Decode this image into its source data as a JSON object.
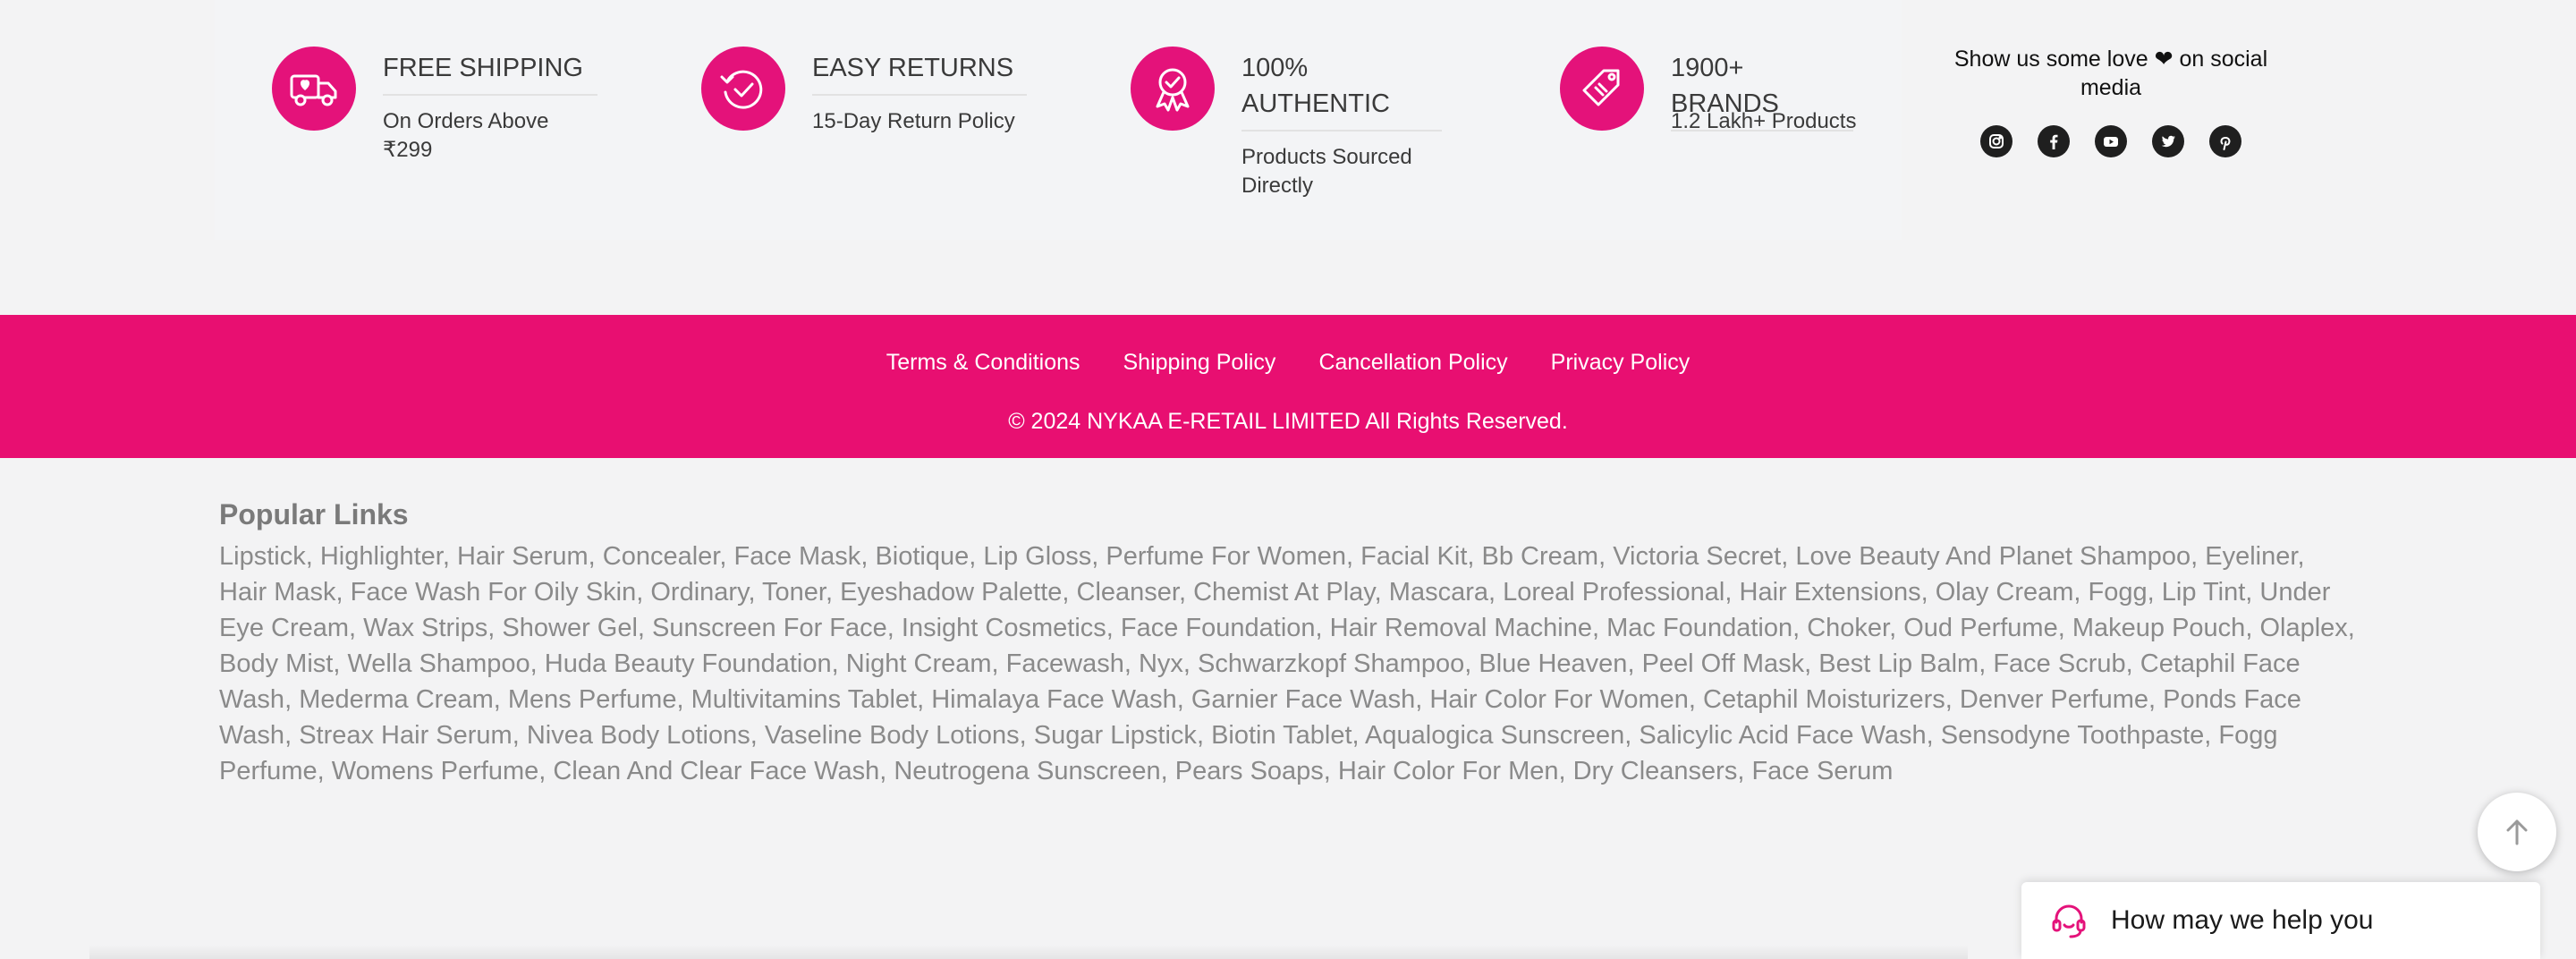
{
  "features": [
    {
      "icon": "delivery-truck-icon",
      "title": "FREE SHIPPING",
      "subtitle": "On Orders Above ₹299"
    },
    {
      "icon": "returns-icon",
      "title": "EASY RETURNS",
      "subtitle": "15-Day Return Policy"
    },
    {
      "icon": "authentic-badge-icon",
      "title": "100% AUTHENTIC",
      "subtitle": "Products Sourced Directly"
    },
    {
      "icon": "price-tag-icon",
      "title": "1900+ BRANDS",
      "subtitle": "1.2 Lakh+ Products"
    }
  ],
  "social": {
    "title": "Show us some love ❤ on social media",
    "icons": [
      "instagram-icon",
      "facebook-icon",
      "youtube-icon",
      "twitter-icon",
      "pinterest-icon"
    ]
  },
  "footer": {
    "links": [
      "Terms & Conditions",
      "Shipping Policy",
      "Cancellation Policy",
      "Privacy Policy"
    ],
    "copyright": "© 2024 NYKAA E-RETAIL LIMITED All Rights Reserved."
  },
  "popular_links": {
    "heading": "Popular Links",
    "items": [
      "Lipstick",
      "Highlighter",
      "Hair Serum",
      "Concealer",
      "Face Mask",
      "Biotique",
      "Lip Gloss",
      "Perfume For Women",
      "Facial Kit",
      "Bb Cream",
      "Victoria Secret",
      "Love Beauty And Planet Shampoo",
      "Eyeliner",
      "Hair Mask",
      "Face Wash For Oily Skin",
      "Ordinary",
      "Toner",
      "Eyeshadow Palette",
      "Cleanser",
      "Chemist At Play",
      "Mascara",
      "Loreal Professional",
      "Hair Extensions",
      "Olay Cream",
      "Fogg",
      "Lip Tint",
      "Under Eye Cream",
      "Wax Strips",
      "Shower Gel",
      "Sunscreen For Face",
      "Insight Cosmetics",
      "Face Foundation",
      "Hair Removal Machine",
      "Mac Foundation",
      "Choker",
      "Oud Perfume",
      "Makeup Pouch",
      "Olaplex",
      "Body Mist",
      "Wella Shampoo",
      "Huda Beauty Foundation",
      "Night Cream",
      "Facewash",
      "Nyx",
      "Schwarzkopf Shampoo",
      "Blue Heaven",
      "Peel Off Mask",
      "Best Lip Balm",
      "Face Scrub",
      "Cetaphil Face Wash",
      "Mederma Cream",
      "Mens Perfume",
      "Multivitamins Tablet",
      "Himalaya Face Wash",
      "Garnier Face Wash",
      "Hair Color For Women",
      "Cetaphil Moisturizers",
      "Denver Perfume",
      "Ponds Face Wash",
      "Streax Hair Serum",
      "Nivea Body Lotions",
      "Vaseline Body Lotions",
      "Sugar Lipstick",
      "Biotin Tablet",
      "Aqualogica Sunscreen",
      "Salicylic Acid Face Wash",
      "Sensodyne Toothpaste",
      "Fogg Perfume",
      "Womens Perfume",
      "Clean And Clear Face Wash",
      "Neutrogena Sunscreen",
      "Pears Soaps",
      "Hair Color For Men",
      "Dry Cleansers",
      "Face Serum"
    ]
  },
  "help_widget": {
    "text": "How may we help you",
    "icon": "headset-icon"
  },
  "scroll_top": {
    "icon": "arrow-up-icon"
  },
  "colors": {
    "brand": "#e80f71",
    "icon_circle": "#e4127a"
  }
}
